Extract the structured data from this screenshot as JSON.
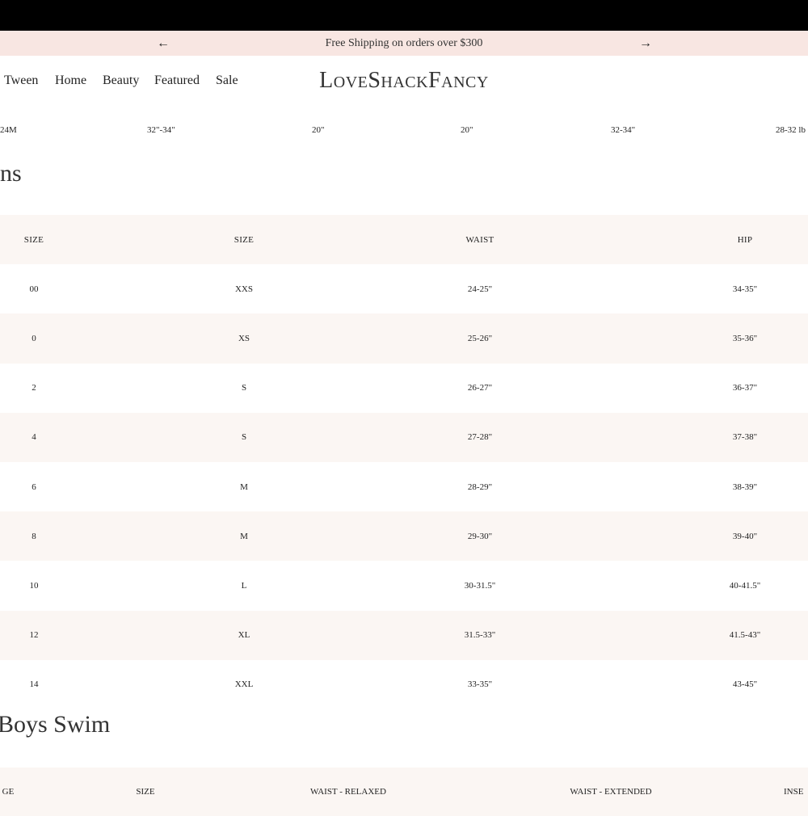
{
  "announcement": {
    "text": "Free Shipping on orders over $300",
    "prev_icon": "←",
    "next_icon": "→"
  },
  "nav": {
    "items": [
      "Tween",
      "Home",
      "Beauty",
      "Featured",
      "Sale"
    ],
    "logo": "LoveShackFancy"
  },
  "previous_table_last_row": [
    "24M",
    "32\"-34\"",
    "20\"",
    "20\"",
    "32-34\"",
    "28-32 lb"
  ],
  "section1": {
    "title": "ns",
    "headers": [
      "SIZE",
      "SIZE",
      "WAIST",
      "HIP"
    ],
    "rows": [
      [
        "00",
        "XXS",
        "24-25\"",
        "34-35\""
      ],
      [
        "0",
        "XS",
        "25-26\"",
        "35-36\""
      ],
      [
        "2",
        "S",
        "26-27\"",
        "36-37\""
      ],
      [
        "4",
        "S",
        "27-28\"",
        "37-38\""
      ],
      [
        "6",
        "M",
        "28-29\"",
        "38-39\""
      ],
      [
        "8",
        "M",
        "29-30\"",
        "39-40\""
      ],
      [
        "10",
        "L",
        "30-31.5\"",
        "40-41.5\""
      ],
      [
        "12",
        "XL",
        "31.5-33\"",
        "41.5-43\""
      ],
      [
        "14",
        "XXL",
        "33-35\"",
        "43-45\""
      ]
    ]
  },
  "section2": {
    "title": "Boys Swim",
    "headers": [
      "GE",
      "SIZE",
      "WAIST - RELAXED",
      "WAIST - EXTENDED",
      "INSE"
    ]
  }
}
